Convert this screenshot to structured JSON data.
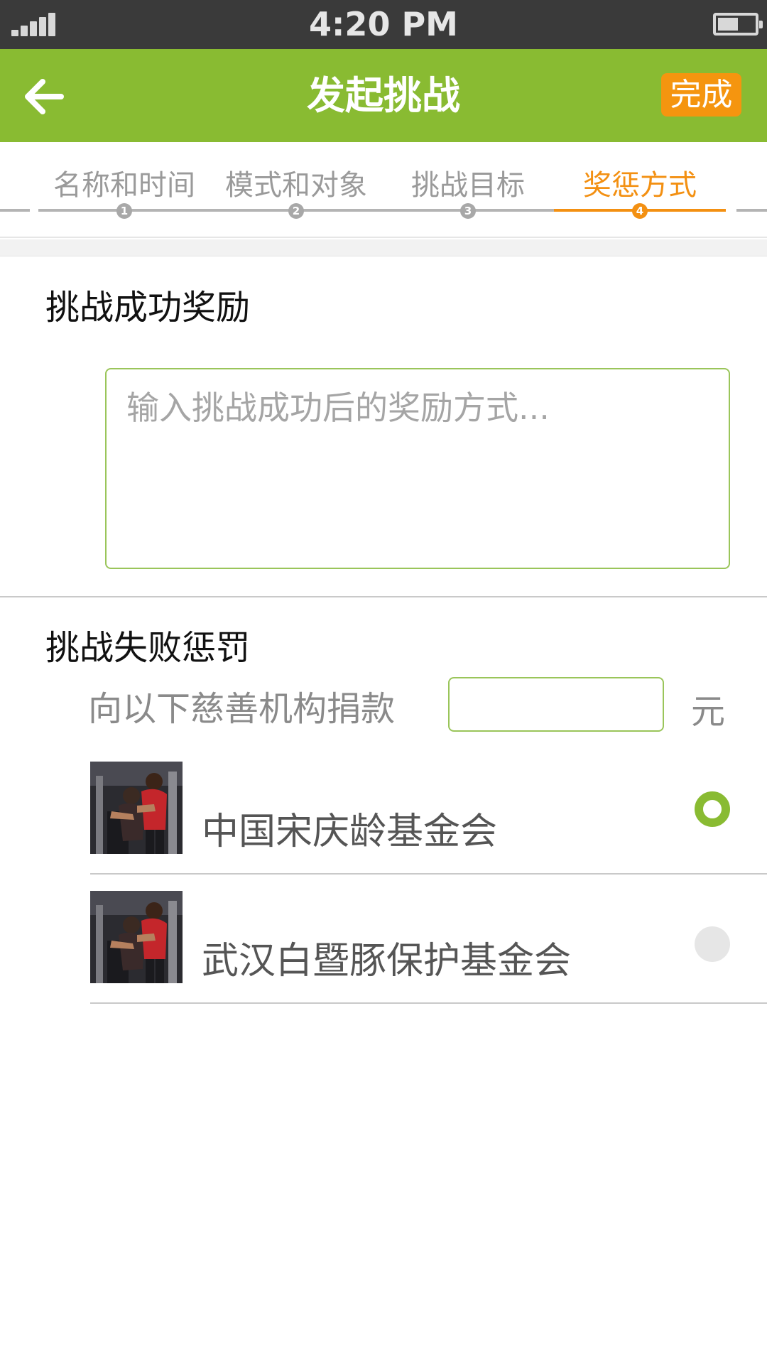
{
  "status_bar": {
    "time": "4:20 PM",
    "battery_level": 0.55
  },
  "nav": {
    "title": "发起挑战",
    "done_label": "完成",
    "brand_color": "#89bb32",
    "accent_color": "#f5950f"
  },
  "steps": [
    {
      "label": "名称和时间",
      "number": "1",
      "active": false
    },
    {
      "label": "模式和对象",
      "number": "2",
      "active": false
    },
    {
      "label": "挑战目标",
      "number": "3",
      "active": false
    },
    {
      "label": "奖惩方式",
      "number": "4",
      "active": true
    }
  ],
  "reward": {
    "title": "挑战成功奖励",
    "placeholder": "输入挑战成功后的奖励方式..."
  },
  "penalty": {
    "title": "挑战失败惩罚",
    "donate_label": "向以下慈善机构捐款",
    "amount_value": "",
    "unit": "元",
    "orgs": [
      {
        "name": "中国宋庆龄基金会",
        "selected": true,
        "icon": "gym-training-photo"
      },
      {
        "name": "武汉白暨豚保护基金会",
        "selected": false,
        "icon": "gym-training-photo"
      }
    ]
  }
}
